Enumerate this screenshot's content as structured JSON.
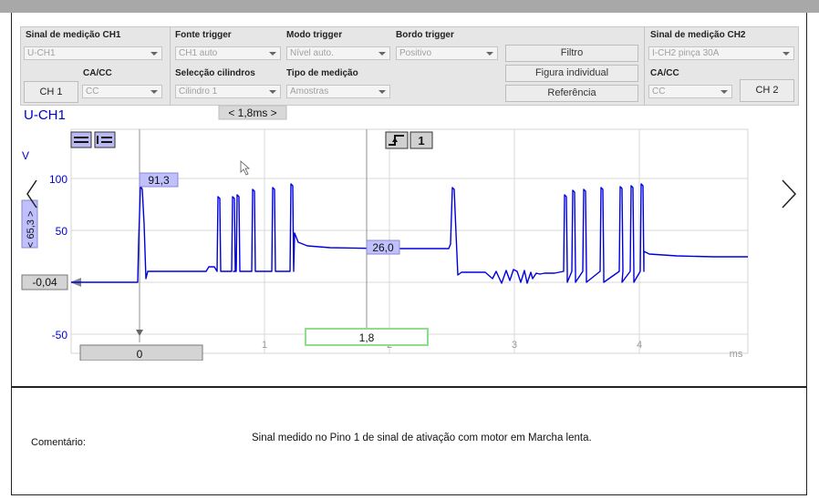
{
  "toolbar": {
    "ch1_signal_label": "Sinal de medição CH1",
    "ch1_signal_value": "U-CH1",
    "acdc_label_ch1": "CA/CC",
    "ch1_button": "CH 1",
    "acdc_value_ch1": "CC",
    "trigger_source_label": "Fonte trigger",
    "trigger_source_value": "CH1 auto",
    "cylinder_select_label": "Selecção cilindros",
    "cylinder_select_value": "Cilindro 1",
    "trigger_mode_label": "Modo trigger",
    "trigger_mode_value": "Nível auto.",
    "measurement_type_label": "Tipo de medição",
    "measurement_type_value": "Amostras",
    "trigger_edge_label": "Bordo trigger",
    "trigger_edge_value": "Positivo",
    "filter_button": "Filtro",
    "single_figure_button": "Figura individual",
    "reference_button": "Referência",
    "ch2_signal_label": "Sinal de medição CH2",
    "ch2_signal_value": "I-CH2 pinça 30A",
    "acdc_label_ch2": "CA/CC",
    "acdc_value_ch2": "CC",
    "ch2_button": "CH 2"
  },
  "scope": {
    "channel_title": "U-CH1",
    "timebase": "< 1,8ms >",
    "y_unit": "V",
    "y_ticks": [
      "100",
      "50",
      "-50"
    ],
    "y_scale_marker": "< 65,3 >",
    "offset_marker": "-0,04",
    "cursor1_value": "91,3",
    "cursor2_value": "26,0",
    "trigger_channel": "1",
    "x_ticks": [
      "0",
      "1",
      "2",
      "3",
      "4"
    ],
    "x_unit": "ms",
    "cursor_time_left": "0",
    "cursor_time_mid": "1,8",
    "colors": {
      "trace": "#0000dd",
      "marker_bg": "#c0c0ff",
      "cursor_box": "#8ede8e"
    }
  },
  "comment": {
    "label": "Comentário:",
    "text": "Sinal medido no Pino 1 de sinal de ativação com motor em Marcha lenta."
  }
}
